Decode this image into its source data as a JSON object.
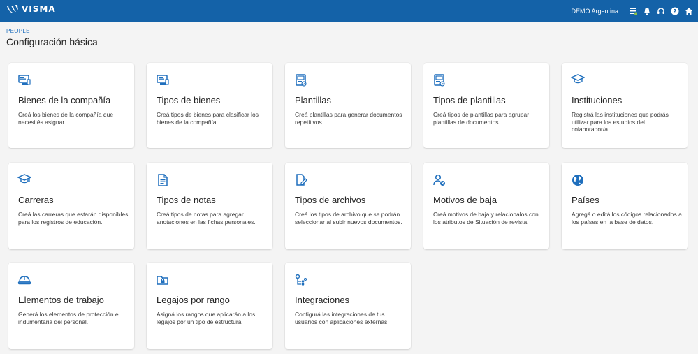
{
  "header": {
    "brand": "VISMA",
    "company": "DEMO Argentina",
    "icons": [
      "list-icon",
      "bell-icon",
      "headset-icon",
      "help-icon",
      "home-icon"
    ]
  },
  "breadcrumb": "PEOPLE",
  "page_title": "Configuración básica",
  "accent_color": "#1462a8",
  "cards": [
    {
      "icon": "computer-icon",
      "title": "Bienes de la compañía",
      "desc": "Creá los bienes de la compañía que necesités asignar."
    },
    {
      "icon": "computer-icon",
      "title": "Tipos de bienes",
      "desc": "Creá tipos de bienes para clasificar los bienes de la compañía."
    },
    {
      "icon": "template-icon",
      "title": "Plantillas",
      "desc": "Creá plantillas para generar documentos repetitivos."
    },
    {
      "icon": "template-icon",
      "title": "Tipos de plantillas",
      "desc": "Creá tipos de plantillas para agrupar plantillas de documentos."
    },
    {
      "icon": "graduation-cap-icon",
      "title": "Instituciones",
      "desc": "Registrá las instituciones que podrás utilizar para los estudios del colaborador/a."
    },
    {
      "icon": "graduation-cap-icon",
      "title": "Carreras",
      "desc": "Creá las carreras que estarán disponibles para los registros de educación."
    },
    {
      "icon": "document-icon",
      "title": "Tipos de notas",
      "desc": "Creá tipos de notas para agregar anotaciones en las fichas personales."
    },
    {
      "icon": "file-edit-icon",
      "title": "Tipos de archivos",
      "desc": "Creá los tipos de archivo que se podrán seleccionar al subir nuevos documentos."
    },
    {
      "icon": "user-remove-icon",
      "title": "Motivos de baja",
      "desc": "Creá motivos de baja y relacionalos con los atributos de Situación de revista."
    },
    {
      "icon": "globe-icon",
      "title": "Países",
      "desc": "Agregá o editá los códigos relacionados a los países en la base de datos."
    },
    {
      "icon": "hard-hat-icon",
      "title": "Elementos de trabajo",
      "desc": "Generá los elementos de protección e indumentaria del personal."
    },
    {
      "icon": "folder-lock-icon",
      "title": "Legajos por rango",
      "desc": "Asigná los rangos que aplicarán a los legajos por un tipo de estructura."
    },
    {
      "icon": "integration-icon",
      "title": "Integraciones",
      "desc": "Configurá las integraciones de tus usuarios con aplicaciones externas."
    }
  ]
}
